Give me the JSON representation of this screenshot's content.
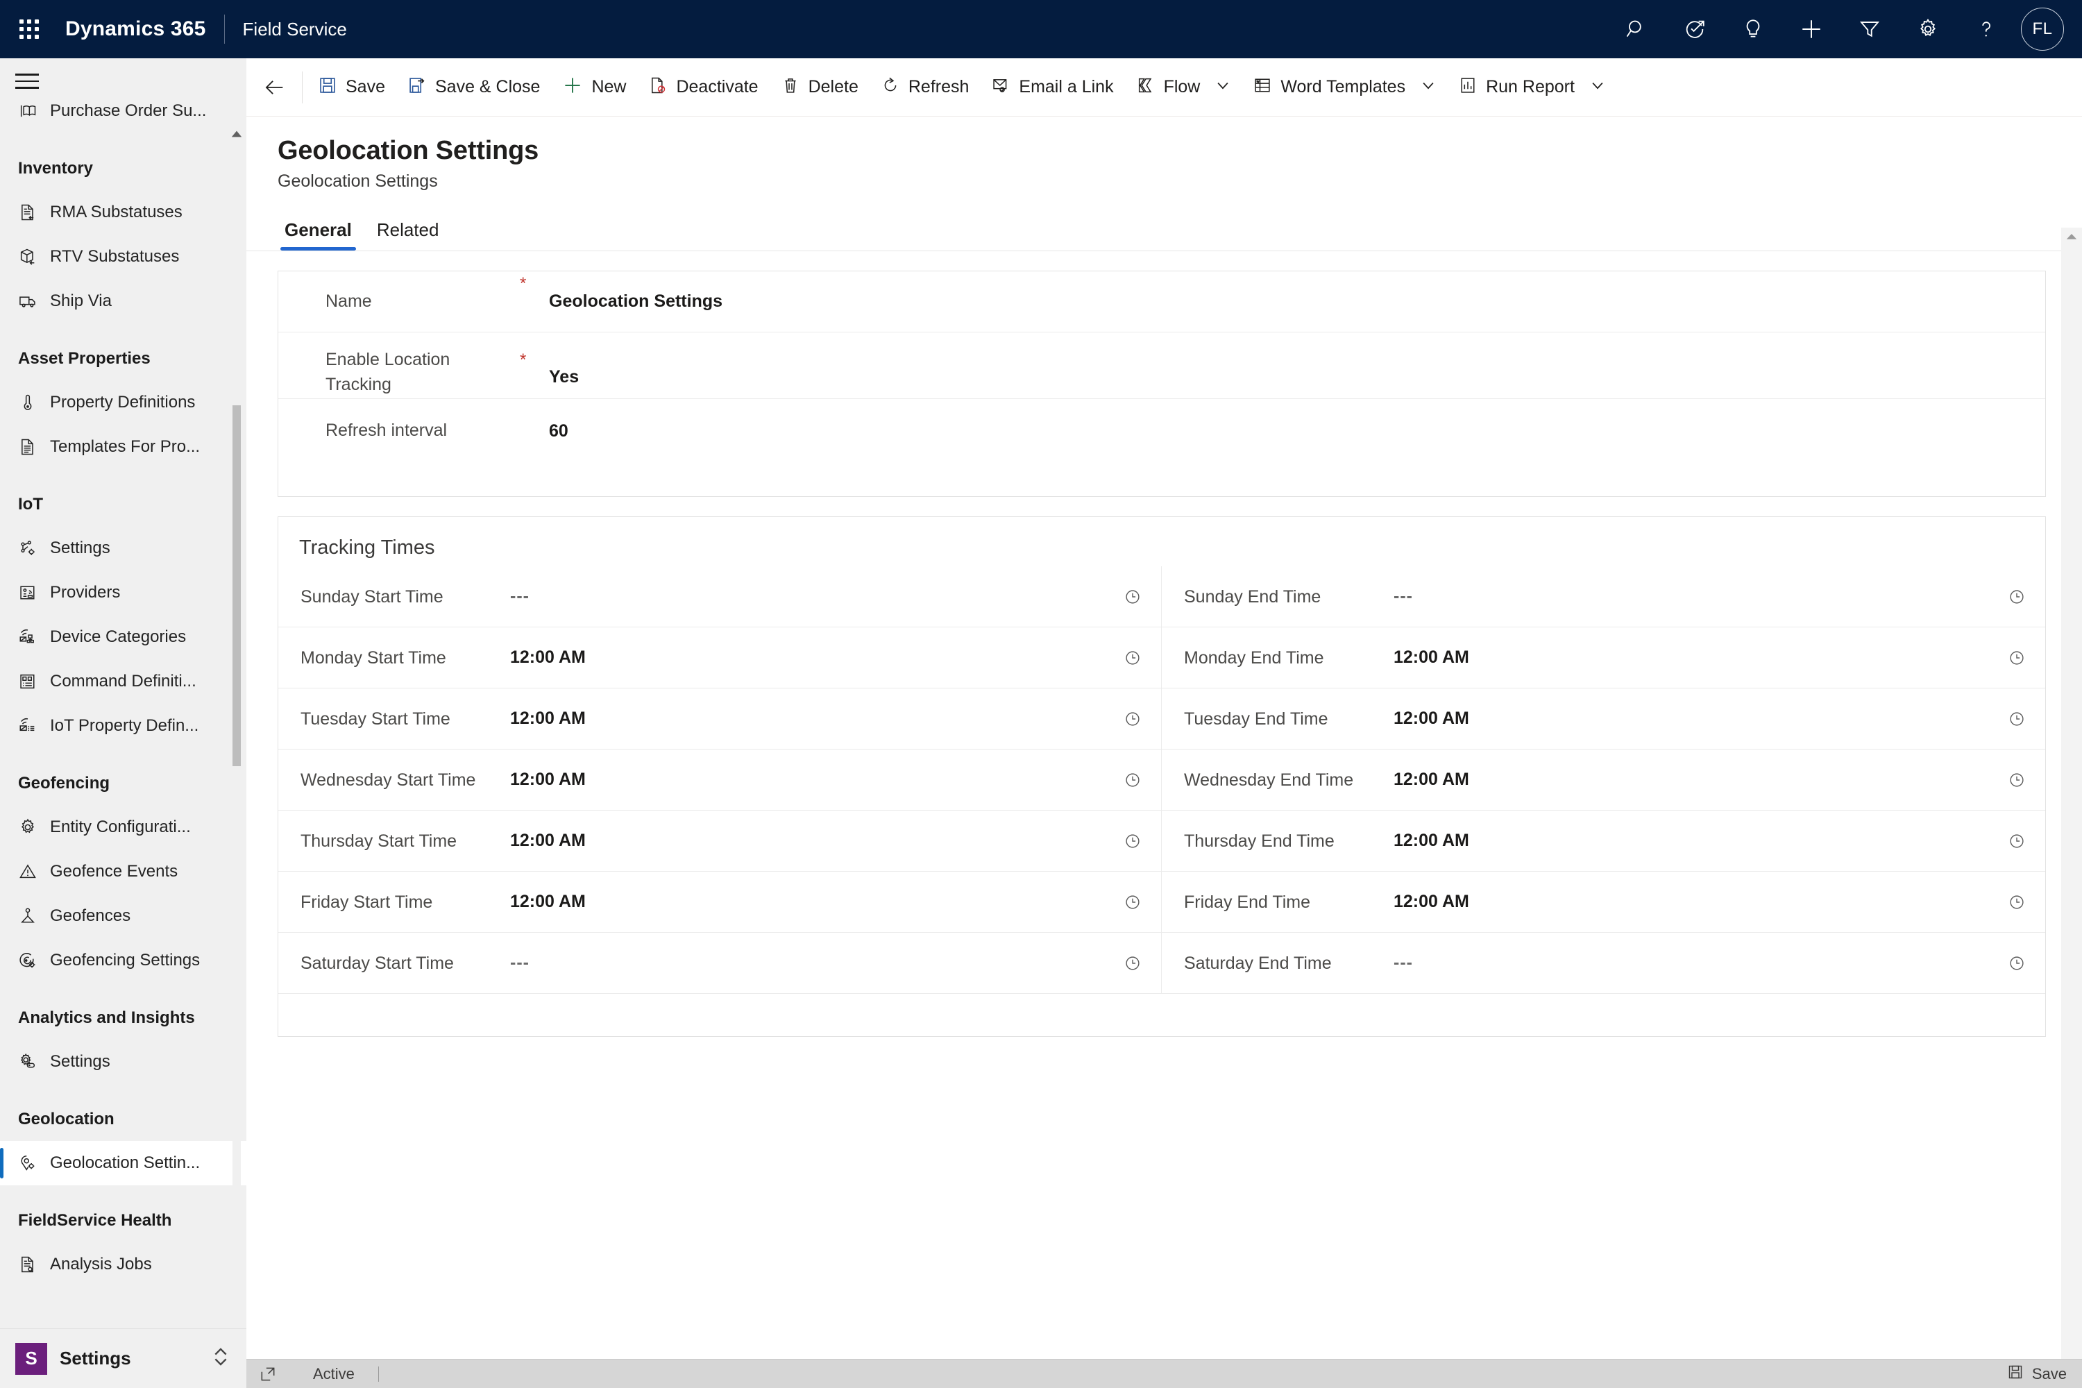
{
  "topbar": {
    "waffle_label": "app-launcher",
    "brand": "Dynamics 365",
    "app_name": "Field Service",
    "icons": [
      {
        "name": "search-icon",
        "label": "Search"
      },
      {
        "name": "assistant-icon",
        "label": "Relevance Assistant"
      },
      {
        "name": "lightbulb-icon",
        "label": "Insights"
      },
      {
        "name": "plus-icon",
        "label": "Quick Create"
      },
      {
        "name": "filter-icon",
        "label": "Filter"
      },
      {
        "name": "gear-icon",
        "label": "Settings"
      },
      {
        "name": "help-icon",
        "label": "Help"
      }
    ],
    "avatar_initials": "FL"
  },
  "commandbar": {
    "back_label": "Back",
    "buttons": [
      {
        "name": "save-button",
        "label": "Save",
        "icon": "save-icon",
        "caret": false
      },
      {
        "name": "save-and-close-button",
        "label": "Save & Close",
        "icon": "save-close-icon",
        "caret": false
      },
      {
        "name": "new-button",
        "label": "New",
        "icon": "plus-icon",
        "caret": false
      },
      {
        "name": "deactivate-button",
        "label": "Deactivate",
        "icon": "deactivate-icon",
        "caret": false
      },
      {
        "name": "delete-button",
        "label": "Delete",
        "icon": "trash-icon",
        "caret": false
      },
      {
        "name": "refresh-button",
        "label": "Refresh",
        "icon": "refresh-icon",
        "caret": false
      },
      {
        "name": "email-a-link-button",
        "label": "Email a Link",
        "icon": "email-link-icon",
        "caret": false
      },
      {
        "name": "flow-button",
        "label": "Flow",
        "icon": "flow-icon",
        "caret": true
      },
      {
        "name": "word-templates-button",
        "label": "Word Templates",
        "icon": "word-icon",
        "caret": true
      },
      {
        "name": "run-report-button",
        "label": "Run Report",
        "icon": "report-icon",
        "caret": true
      }
    ]
  },
  "sidebar": {
    "clipped_item": {
      "label": "Purchase Order Su...",
      "icon": "purchase-order-icon"
    },
    "groups": [
      {
        "title": "Inventory",
        "items": [
          {
            "label": "RMA Substatuses",
            "icon": "rma-icon"
          },
          {
            "label": "RTV Substatuses",
            "icon": "rtv-box-icon"
          },
          {
            "label": "Ship Via",
            "icon": "truck-icon"
          }
        ]
      },
      {
        "title": "Asset Properties",
        "items": [
          {
            "label": "Property Definitions",
            "icon": "thermometer-icon"
          },
          {
            "label": "Templates For Pro...",
            "icon": "document-icon"
          }
        ]
      },
      {
        "title": "IoT",
        "items": [
          {
            "label": "Settings",
            "icon": "iot-settings-icon"
          },
          {
            "label": "Providers",
            "icon": "providers-icon"
          },
          {
            "label": "Device Categories",
            "icon": "device-category-icon"
          },
          {
            "label": "Command Definiti...",
            "icon": "command-definition-icon"
          },
          {
            "label": "IoT Property Defin...",
            "icon": "iot-property-icon"
          }
        ]
      },
      {
        "title": "Geofencing",
        "items": [
          {
            "label": "Entity Configurati...",
            "icon": "gear-icon"
          },
          {
            "label": "Geofence Events",
            "icon": "warning-triangle-icon"
          },
          {
            "label": "Geofences",
            "icon": "geofence-icon"
          },
          {
            "label": "Geofencing Settings",
            "icon": "geofencing-settings-icon"
          }
        ]
      },
      {
        "title": "Analytics and Insights",
        "items": [
          {
            "label": "Settings",
            "icon": "analytics-settings-icon"
          }
        ]
      },
      {
        "title": "Geolocation",
        "items": [
          {
            "label": "Geolocation Settin...",
            "icon": "geolocation-pin-icon",
            "active": true
          }
        ]
      },
      {
        "title": "FieldService Health",
        "items": [
          {
            "label": "Analysis Jobs",
            "icon": "analysis-jobs-icon"
          }
        ]
      }
    ],
    "footer": {
      "badge": "S",
      "label": "Settings",
      "chevron": "area-switcher"
    }
  },
  "page": {
    "title": "Geolocation Settings",
    "subtitle": "Geolocation Settings",
    "tabs": [
      {
        "label": "General",
        "active": true
      },
      {
        "label": "Related",
        "active": false
      }
    ]
  },
  "general_fields": [
    {
      "label": "Name",
      "required": true,
      "value": "Geolocation Settings"
    },
    {
      "label": "Enable Location Tracking",
      "required": true,
      "value": "Yes"
    },
    {
      "label": "Refresh interval",
      "required": false,
      "value": "60"
    }
  ],
  "tracking_times": {
    "section_title": "Tracking Times",
    "clock_icon": "clock-icon",
    "start_times": [
      {
        "label": "Sunday Start Time",
        "value": "---",
        "empty": true
      },
      {
        "label": "Monday Start Time",
        "value": "12:00 AM",
        "empty": false
      },
      {
        "label": "Tuesday Start Time",
        "value": "12:00 AM",
        "empty": false
      },
      {
        "label": "Wednesday Start Time",
        "value": "12:00 AM",
        "empty": false
      },
      {
        "label": "Thursday Start Time",
        "value": "12:00 AM",
        "empty": false
      },
      {
        "label": "Friday Start Time",
        "value": "12:00 AM",
        "empty": false
      },
      {
        "label": "Saturday Start Time",
        "value": "---",
        "empty": true
      }
    ],
    "end_times": [
      {
        "label": "Sunday End Time",
        "value": "---",
        "empty": true
      },
      {
        "label": "Monday End Time",
        "value": "12:00 AM",
        "empty": false
      },
      {
        "label": "Tuesday End Time",
        "value": "12:00 AM",
        "empty": false
      },
      {
        "label": "Wednesday End Time",
        "value": "12:00 AM",
        "empty": false
      },
      {
        "label": "Thursday End Time",
        "value": "12:00 AM",
        "empty": false
      },
      {
        "label": "Friday End Time",
        "value": "12:00 AM",
        "empty": false
      },
      {
        "label": "Saturday End Time",
        "value": "---",
        "empty": true
      }
    ]
  },
  "statusbar": {
    "popout_icon": "popout-icon",
    "status": "Active",
    "save_label": "Save",
    "save_icon": "save-icon"
  },
  "colors": {
    "topbar_bg": "#041C3F",
    "accent_blue": "#0f6cbd",
    "tab_underline": "#2266cf",
    "required_red": "#c1362e",
    "sidebar_bg": "#f0f0f0",
    "statusbar_bg": "#d6d6d6",
    "settings_badge": "#6b1f7c"
  }
}
